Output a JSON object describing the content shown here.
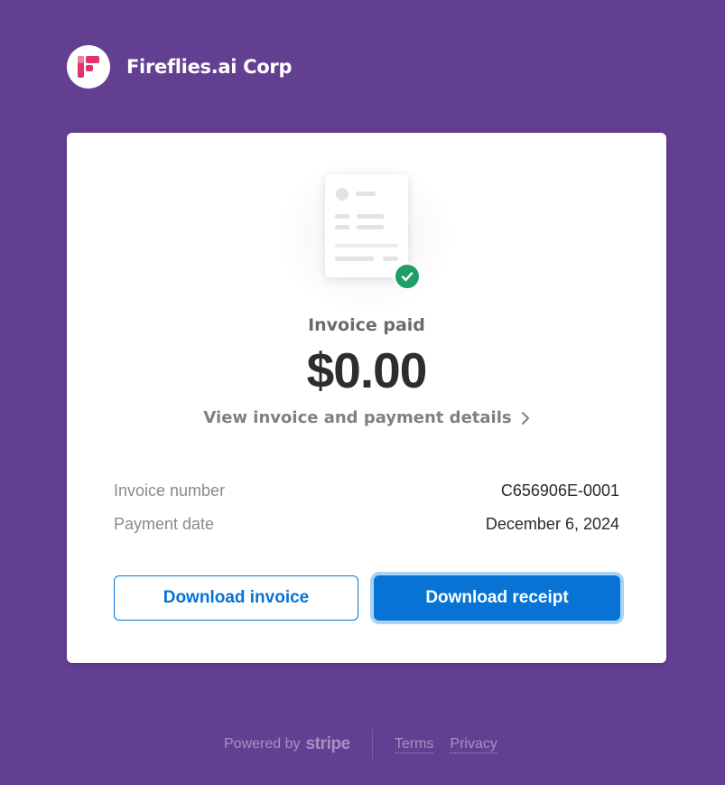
{
  "company": {
    "name": "Fireflies.ai Corp",
    "logo_icon": "fireflies-logo-icon",
    "brand_colors": [
      "#e5326d",
      "#7b2c8f"
    ]
  },
  "invoice": {
    "status": "Invoice paid",
    "amount": "$0.00",
    "details_link": "View invoice and payment details",
    "details_icon": "chevron-right-icon",
    "status_icon": "check-circle-icon",
    "status_color": "#1f9f66"
  },
  "details": [
    {
      "label": "Invoice number",
      "value": "C656906E-0001"
    },
    {
      "label": "Payment date",
      "value": "December 6, 2024"
    }
  ],
  "actions": {
    "download_invoice": "Download invoice",
    "download_receipt": "Download receipt",
    "accent_color": "#0773d4"
  },
  "footer": {
    "powered_by": "Powered by",
    "brand": "stripe",
    "terms": "Terms",
    "privacy": "Privacy"
  },
  "background_color": "#633f91"
}
